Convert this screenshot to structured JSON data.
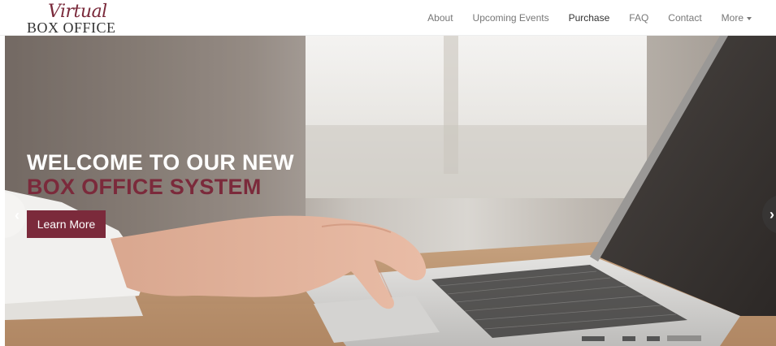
{
  "brand": {
    "script": "Virtual",
    "main": "BOX OFFICE",
    "color": "#7b2a3b"
  },
  "nav": {
    "items": [
      {
        "label": "About",
        "active": false
      },
      {
        "label": "Upcoming Events",
        "active": false
      },
      {
        "label": "Purchase",
        "active": true
      },
      {
        "label": "FAQ",
        "active": false
      },
      {
        "label": "Contact",
        "active": false
      },
      {
        "label": "More",
        "active": false,
        "dropdown": true
      }
    ]
  },
  "hero": {
    "title_line1": "WELCOME TO OUR NEW",
    "title_line2": "BOX OFFICE SYSTEM",
    "button_label": "Learn More",
    "prev_icon": "chevron-left-icon",
    "next_icon": "chevron-right-icon",
    "prev_glyph": "‹",
    "next_glyph": "›"
  }
}
